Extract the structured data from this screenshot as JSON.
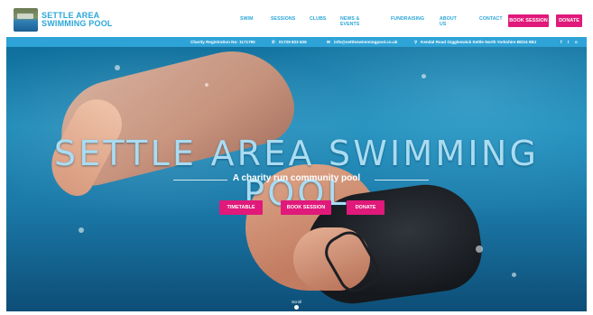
{
  "header": {
    "logo_line1": "SETTLE AREA",
    "logo_line2": "SWIMMING POOL",
    "nav": [
      "SWIM",
      "SESSIONS",
      "CLUBS",
      "NEWS & EVENTS",
      "FUNDRAISING",
      "ABOUT US",
      "CONTACT"
    ],
    "book_session": "BOOK SESSION",
    "donate": "DONATE"
  },
  "infobar": {
    "charity": "Charity Registration No: 1171790",
    "phone_icon": "phone-icon",
    "phone": "01729 823 626",
    "email_icon": "envelope-icon",
    "email": "info@settleswimmingpool.co.uk",
    "location_icon": "map-pin-icon",
    "address": "Kendal Road Giggleswick Settle North Yorkshire BD24 0BJ",
    "social": [
      "f",
      "t",
      "o"
    ]
  },
  "hero": {
    "title": "SETTLE AREA SWIMMING POOL",
    "subtitle": "A charity run community pool",
    "buttons": [
      "TIMETABLE",
      "BOOK SESSION",
      "DONATE"
    ],
    "scroll_label": "Scroll"
  },
  "colors": {
    "brand_blue": "#2aa6d8",
    "accent_pink": "#e0197a"
  }
}
